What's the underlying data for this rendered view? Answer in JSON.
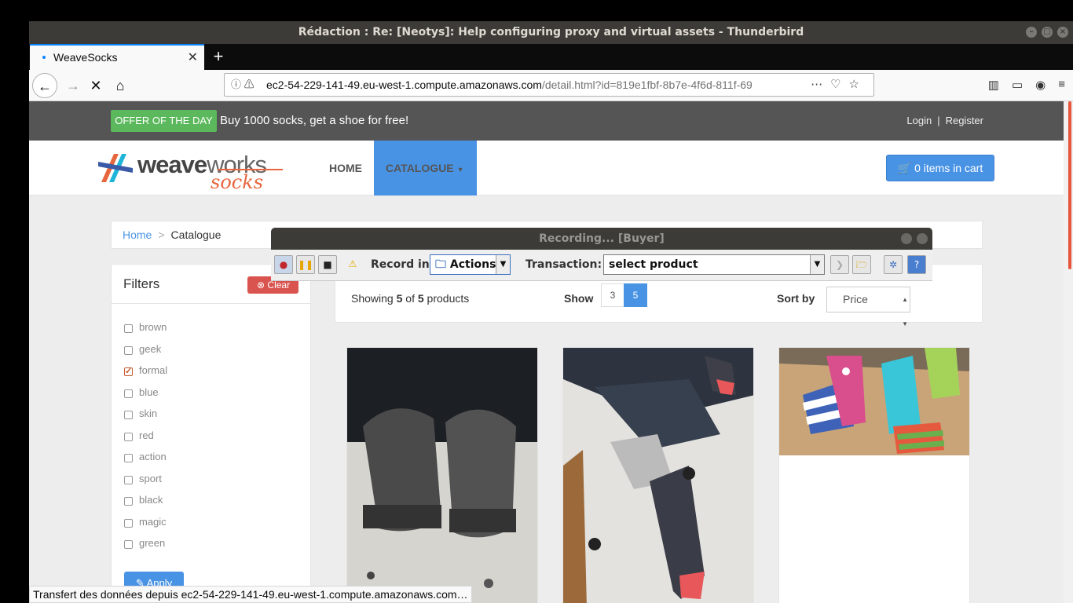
{
  "window": {
    "title": "Rédaction : Re: [Neotys]: Help configuring proxy and virtual assets - Thunderbird"
  },
  "browser": {
    "tab_title": "WeaveSocks",
    "url_host": "ec2-54-229-141-49.eu-west-1.compute.amazonaws.com",
    "url_path": "/detail.html?id=819e1fbf-8b7e-4f6d-811f-69",
    "status_text": "Transfert des données depuis ec2-54-229-141-49.eu-west-1.compute.amazonaws.com…"
  },
  "site": {
    "offer_badge": "OFFER OF THE DAY",
    "offer_text": "Buy 1000 socks, get a shoe for free!",
    "login": "Login",
    "separator": "|",
    "register": "Register",
    "logo_weave": "weave",
    "logo_works": "works",
    "logo_socks": "socks",
    "nav_home": "HOME",
    "nav_catalogue": "CATALOGUE",
    "cart": "0 items in cart"
  },
  "breadcrumb": {
    "home": "Home",
    "separator": ">",
    "current": "Catalogue"
  },
  "filters": {
    "title": "Filters",
    "clear": "Clear",
    "apply": "Apply",
    "items": [
      {
        "label": "brown",
        "checked": false
      },
      {
        "label": "geek",
        "checked": false
      },
      {
        "label": "formal",
        "checked": true
      },
      {
        "label": "blue",
        "checked": false
      },
      {
        "label": "skin",
        "checked": false
      },
      {
        "label": "red",
        "checked": false
      },
      {
        "label": "action",
        "checked": false
      },
      {
        "label": "sport",
        "checked": false
      },
      {
        "label": "black",
        "checked": false
      },
      {
        "label": "magic",
        "checked": false
      },
      {
        "label": "green",
        "checked": false
      }
    ]
  },
  "products_bar": {
    "showing_prefix": "Showing",
    "showing_count": "5",
    "showing_of": "of",
    "showing_total": "5",
    "showing_suffix": "products",
    "show_label": "Show",
    "page_options": [
      "3",
      "5"
    ],
    "sort_label": "Sort by",
    "sort_value": "Price"
  },
  "recorder": {
    "title": "Recording... [Buyer]",
    "record_in_label": "Record in:",
    "record_in_value": "Actions",
    "transaction_label": "Transaction:",
    "transaction_value": "select product"
  },
  "colors": {
    "accent_blue": "#4993e4",
    "offer_green": "#5cb85c",
    "clear_red": "#d9534f",
    "logo_orange": "#e8663d"
  }
}
